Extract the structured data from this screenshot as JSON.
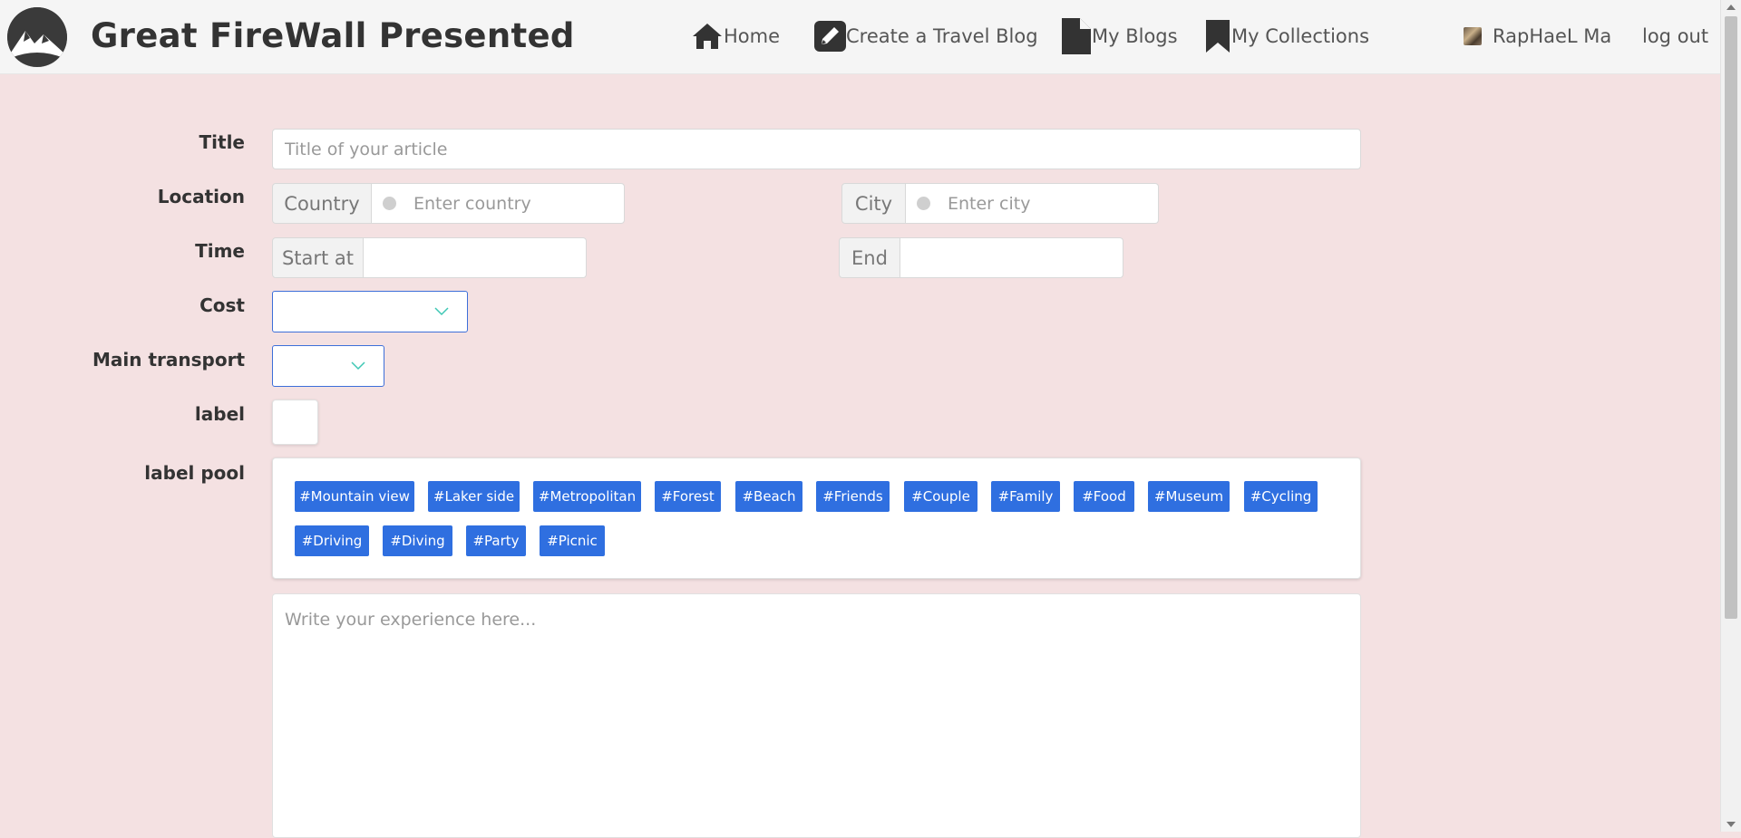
{
  "header": {
    "brand": "Great FireWall Presented",
    "nav": [
      {
        "label": "Home",
        "icon": "home-icon"
      },
      {
        "label": "Create a Travel Blog",
        "icon": "pencil-icon"
      },
      {
        "label": "My Blogs",
        "icon": "document-icon"
      },
      {
        "label": "My Collections",
        "icon": "bookmark-icon"
      }
    ],
    "user_name": "RapHaeL Ma",
    "logout": "log out"
  },
  "form": {
    "title_label": "Title",
    "title_placeholder": "Title of your article",
    "location_label": "Location",
    "country_addon": "Country",
    "country_placeholder": "Enter country",
    "city_addon": "City",
    "city_placeholder": "Enter city",
    "time_label": "Time",
    "start_addon": "Start at",
    "end_addon": "End",
    "cost_label": "Cost",
    "transport_label": "Main transport",
    "label_label": "label",
    "pool_label": "label pool",
    "tags": [
      "#Mountain view",
      "#Laker side",
      "#Metropolitan",
      "#Forest",
      "#Beach",
      "#Friends",
      "#Couple",
      "#Family",
      "#Food",
      "#Museum",
      "#Cycling",
      "#Driving",
      "#Diving",
      "#Party",
      "#Picnic"
    ],
    "content_placeholder": "Write your experience here..."
  },
  "colors": {
    "page_bg": "#f4e1e2",
    "tag_bg": "#2f6fe0",
    "select_border": "#3d6fd9",
    "chevron": "#3ec7b4"
  }
}
